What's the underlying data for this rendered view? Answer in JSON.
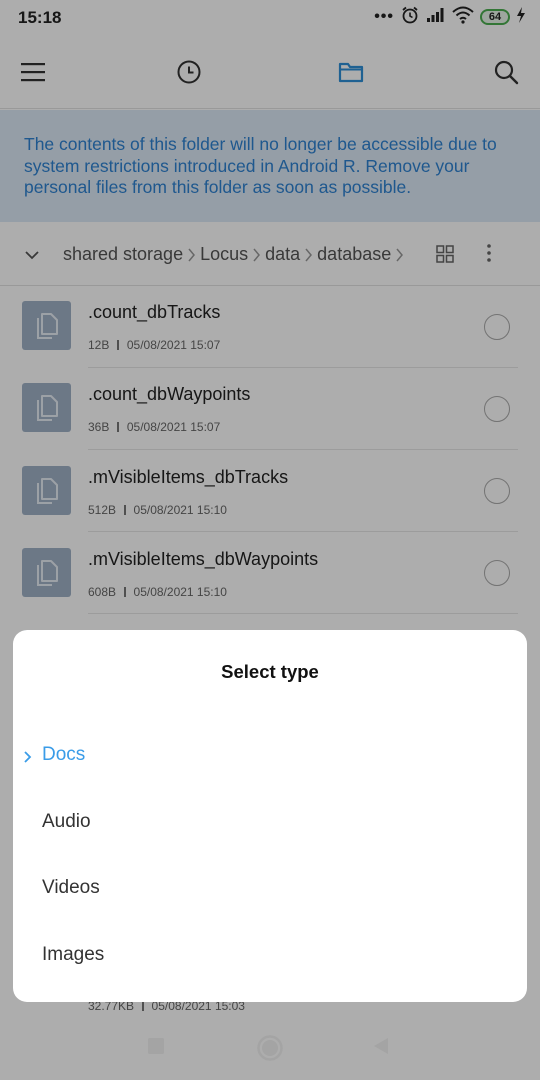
{
  "status_bar": {
    "time": "15:18",
    "more_indicator": "•••",
    "battery_level": "64",
    "icons": [
      "alarm-icon",
      "signal-icon",
      "wifi-icon",
      "battery-icon",
      "charging-icon"
    ]
  },
  "toolbar": {
    "icons": [
      "menu-icon",
      "recent-icon",
      "folder-icon",
      "search-icon"
    ],
    "accent_color": "#2e8fd8"
  },
  "notice": {
    "text": "The contents of this folder will no longer be accessible due to system restrictions introduced in Android R. Remove your personal files from this folder as soon as possible."
  },
  "breadcrumb": {
    "items": [
      "shared storage",
      "Locus",
      "data",
      "database"
    ]
  },
  "files": [
    {
      "name": ".count_dbTracks",
      "size": "12B",
      "date": "05/08/2021 15:07"
    },
    {
      "name": ".count_dbWaypoints",
      "size": "36B",
      "date": "05/08/2021 15:07"
    },
    {
      "name": ".mVisibleItems_dbTracks",
      "size": "512B",
      "date": "05/08/2021 15:10"
    },
    {
      "name": ".mVisibleItems_dbWaypoints",
      "size": "608B",
      "date": "05/08/2021 15:10"
    },
    {
      "name": "",
      "size": "32.77KB",
      "date": "05/08/2021 15:03"
    }
  ],
  "sheet": {
    "title": "Select type",
    "options": [
      "Docs",
      "Audio",
      "Videos",
      "Images"
    ],
    "selected": "Docs",
    "selected_color": "#3a9ce8"
  },
  "nav_bar": {
    "icons": [
      "recents-square-icon",
      "home-circle-icon",
      "back-triangle-icon"
    ]
  }
}
